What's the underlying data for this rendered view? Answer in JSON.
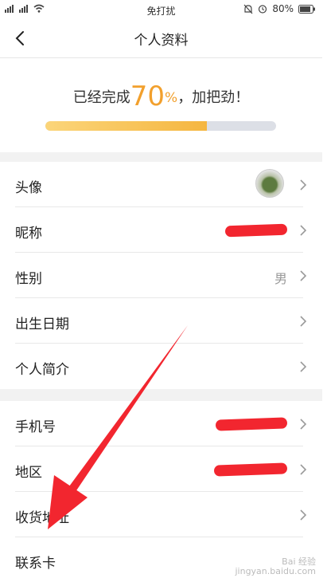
{
  "status_bar": {
    "left_icons": [
      "signal-icon",
      "signal-icon",
      "wifi-icon"
    ],
    "center": "免打扰",
    "battery": "80%"
  },
  "nav": {
    "title": "个人资料"
  },
  "progress": {
    "prefix": "已经完成",
    "value": "70",
    "percent_sign": "%",
    "suffix": "，加把劲！",
    "fraction": 0.7
  },
  "profile_group": [
    {
      "label": "头像",
      "value": ""
    },
    {
      "label": "昵称",
      "value": ""
    },
    {
      "label": "性别",
      "value": "男"
    },
    {
      "label": "出生日期",
      "value": ""
    },
    {
      "label": "个人简介",
      "value": ""
    }
  ],
  "contact_group": [
    {
      "label": "手机号",
      "value": ""
    },
    {
      "label": "地区",
      "value": ""
    },
    {
      "label": "收货地址",
      "value": ""
    },
    {
      "label": "联系卡",
      "value": ""
    }
  ],
  "watermark": {
    "line1": "Bai 经验",
    "line2": "jingyan.baidu.com"
  },
  "colors": {
    "accent": "#f2a02d",
    "redaction": "#f2262f",
    "arrow": "#f2262f"
  }
}
